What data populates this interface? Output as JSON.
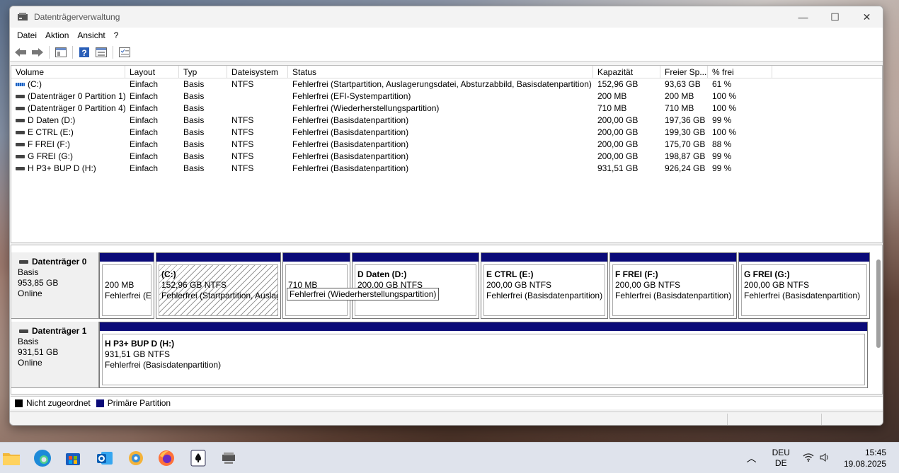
{
  "window": {
    "title": "Datenträgerverwaltung",
    "minimize": "—",
    "maximize": "☐",
    "close": "✕"
  },
  "menu": [
    "Datei",
    "Aktion",
    "Ansicht",
    "?"
  ],
  "columns": [
    "Volume",
    "Layout",
    "Typ",
    "Dateisystem",
    "Status",
    "Kapazität",
    "Freier Sp...",
    "% frei"
  ],
  "volumes": [
    {
      "icon": "system-volume-icon",
      "name": "(C:)",
      "layout": "Einfach",
      "type": "Basis",
      "fs": "NTFS",
      "status": "Fehlerfrei (Startpartition, Auslagerungsdatei, Absturzabbild, Basisdatenpartition)",
      "capacity": "152,96 GB",
      "free": "93,63 GB",
      "pct": "61 %"
    },
    {
      "icon": "volume-icon",
      "name": "(Datenträger 0 Partition 1)",
      "layout": "Einfach",
      "type": "Basis",
      "fs": "",
      "status": "Fehlerfrei (EFI-Systempartition)",
      "capacity": "200 MB",
      "free": "200 MB",
      "pct": "100 %"
    },
    {
      "icon": "volume-icon",
      "name": "(Datenträger 0 Partition 4)",
      "layout": "Einfach",
      "type": "Basis",
      "fs": "",
      "status": "Fehlerfrei (Wiederherstellungspartition)",
      "capacity": "710 MB",
      "free": "710 MB",
      "pct": "100 %"
    },
    {
      "icon": "volume-icon",
      "name": "D Daten (D:)",
      "layout": "Einfach",
      "type": "Basis",
      "fs": "NTFS",
      "status": "Fehlerfrei (Basisdatenpartition)",
      "capacity": "200,00 GB",
      "free": "197,36 GB",
      "pct": "99 %"
    },
    {
      "icon": "volume-icon",
      "name": "E CTRL (E:)",
      "layout": "Einfach",
      "type": "Basis",
      "fs": "NTFS",
      "status": "Fehlerfrei (Basisdatenpartition)",
      "capacity": "200,00 GB",
      "free": "199,30 GB",
      "pct": "100 %"
    },
    {
      "icon": "volume-icon",
      "name": "F FREI (F:)",
      "layout": "Einfach",
      "type": "Basis",
      "fs": "NTFS",
      "status": "Fehlerfrei (Basisdatenpartition)",
      "capacity": "200,00 GB",
      "free": "175,70 GB",
      "pct": "88 %"
    },
    {
      "icon": "volume-icon",
      "name": "G FREI (G:)",
      "layout": "Einfach",
      "type": "Basis",
      "fs": "NTFS",
      "status": "Fehlerfrei (Basisdatenpartition)",
      "capacity": "200,00 GB",
      "free": "198,87 GB",
      "pct": "99 %"
    },
    {
      "icon": "volume-icon",
      "name": "H P3+ BUP D (H:)",
      "layout": "Einfach",
      "type": "Basis",
      "fs": "NTFS",
      "status": "Fehlerfrei (Basisdatenpartition)",
      "capacity": "931,51 GB",
      "free": "926,24 GB",
      "pct": "99 %"
    }
  ],
  "disks": [
    {
      "name": "Datenträger 0",
      "type": "Basis",
      "size": "953,85 GB",
      "state": "Online",
      "parts": [
        {
          "title": "",
          "size": "200 MB",
          "status": "Fehlerfrei (E"
        },
        {
          "title": "(C:)",
          "size": "152,96 GB NTFS",
          "status": "Fehlerfrei (Startpartition, Auslag"
        },
        {
          "title": "",
          "size": "710 MB",
          "status": ""
        },
        {
          "title": "D Daten  (D:)",
          "size": "200,00 GB NTFS",
          "status": "partition)"
        },
        {
          "title": "E CTRL  (E:)",
          "size": "200,00 GB NTFS",
          "status": "Fehlerfrei (Basisdatenpartition)"
        },
        {
          "title": "F FREI  (F:)",
          "size": "200,00 GB NTFS",
          "status": "Fehlerfrei (Basisdatenpartition)"
        },
        {
          "title": "G FREI  (G:)",
          "size": "200,00 GB NTFS",
          "status": "Fehlerfrei (Basisdatenpartition)"
        }
      ]
    },
    {
      "name": "Datenträger 1",
      "type": "Basis",
      "size": "931,51 GB",
      "state": "Online",
      "parts": [
        {
          "title": "H P3+ BUP D  (H:)",
          "size": "931,51 GB NTFS",
          "status": "Fehlerfrei (Basisdatenpartition)"
        }
      ]
    }
  ],
  "tooltip": "Fehlerfrei (Wiederherstellungspartition)",
  "legend": {
    "unallocated": "Nicht zugeordnet",
    "primary": "Primäre Partition",
    "unallocated_color": "#000000",
    "primary_color": "#0a0a78"
  },
  "tray": {
    "lang1": "DEU",
    "lang2": "DE",
    "time": "15:45",
    "date": "19.08.2025"
  }
}
